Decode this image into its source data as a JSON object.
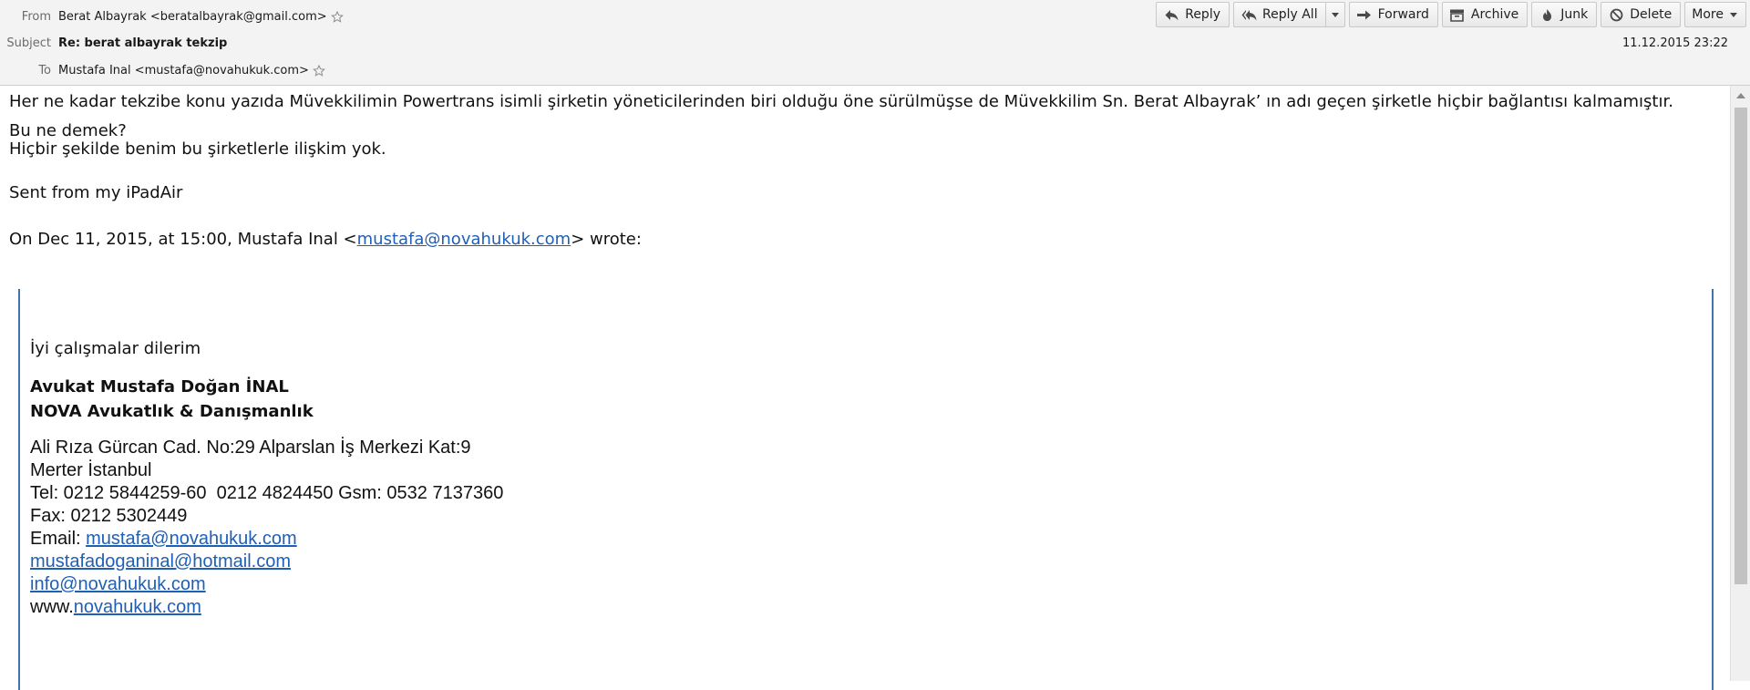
{
  "header": {
    "from_label": "From",
    "from_value": "Berat Albayrak <beratalbayrak@gmail.com>",
    "subject_label": "Subject",
    "subject_value": "Re: berat albayrak tekzip",
    "to_label": "To",
    "to_value": "Mustafa Inal <mustafa@novahukuk.com>",
    "date": "11.12.2015 23:22"
  },
  "toolbar": {
    "reply": "Reply",
    "reply_all": "Reply All",
    "forward": "Forward",
    "archive": "Archive",
    "junk": "Junk",
    "delete": "Delete",
    "more": "More"
  },
  "body": {
    "line1": "Her ne kadar tekzibe konu yazıda Müvekkilimin Powertrans isimli şirketin yöneticilerinden biri olduğu öne sürülmüşse de Müvekkilim Sn. Berat Albayrak’ ın adı geçen şirketle hiçbir bağlantısı kalmamıştır.",
    "line2": "Bu ne demek?",
    "line3": "Hiçbir şekilde benim bu şirketlerle ilişkim yok.",
    "line4": "Sent from my iPadAir",
    "wrote_prefix": "On Dec 11, 2015, at 15:00, Mustafa Inal <",
    "wrote_email": "mustafa@novahukuk.com",
    "wrote_suffix": "> wrote:"
  },
  "quote": {
    "greeting": "İyi çalışmalar dilerim",
    "sig_name": "Avukat Mustafa Doğan İNAL",
    "sig_company": "NOVA Avukatlık & Danışmanlık",
    "address1": "Ali Rıza Gürcan Cad. No:29 Alparslan İş Merkezi Kat:9",
    "address2": "Merter İstanbul",
    "tel": "Tel: 0212 5844259-60  0212 4824450 Gsm: 0532 7137360",
    "fax": "Fax: 0212 5302449",
    "email_label": "Email: ",
    "email1": "mustafa@novahukuk.com",
    "email2": "mustafadoganinal@hotmail.com",
    "email3": "info@novahukuk.com",
    "www_prefix": "www.",
    "website": "novahukuk.com"
  },
  "colors": {
    "link": "#1f5fb5",
    "quote_border": "#3e73b0",
    "header_bg": "#f3f3f3"
  },
  "icons": [
    "star-icon",
    "reply-icon",
    "reply-all-icon",
    "forward-icon",
    "archive-icon",
    "junk-icon",
    "delete-icon",
    "chevron-down-icon"
  ]
}
